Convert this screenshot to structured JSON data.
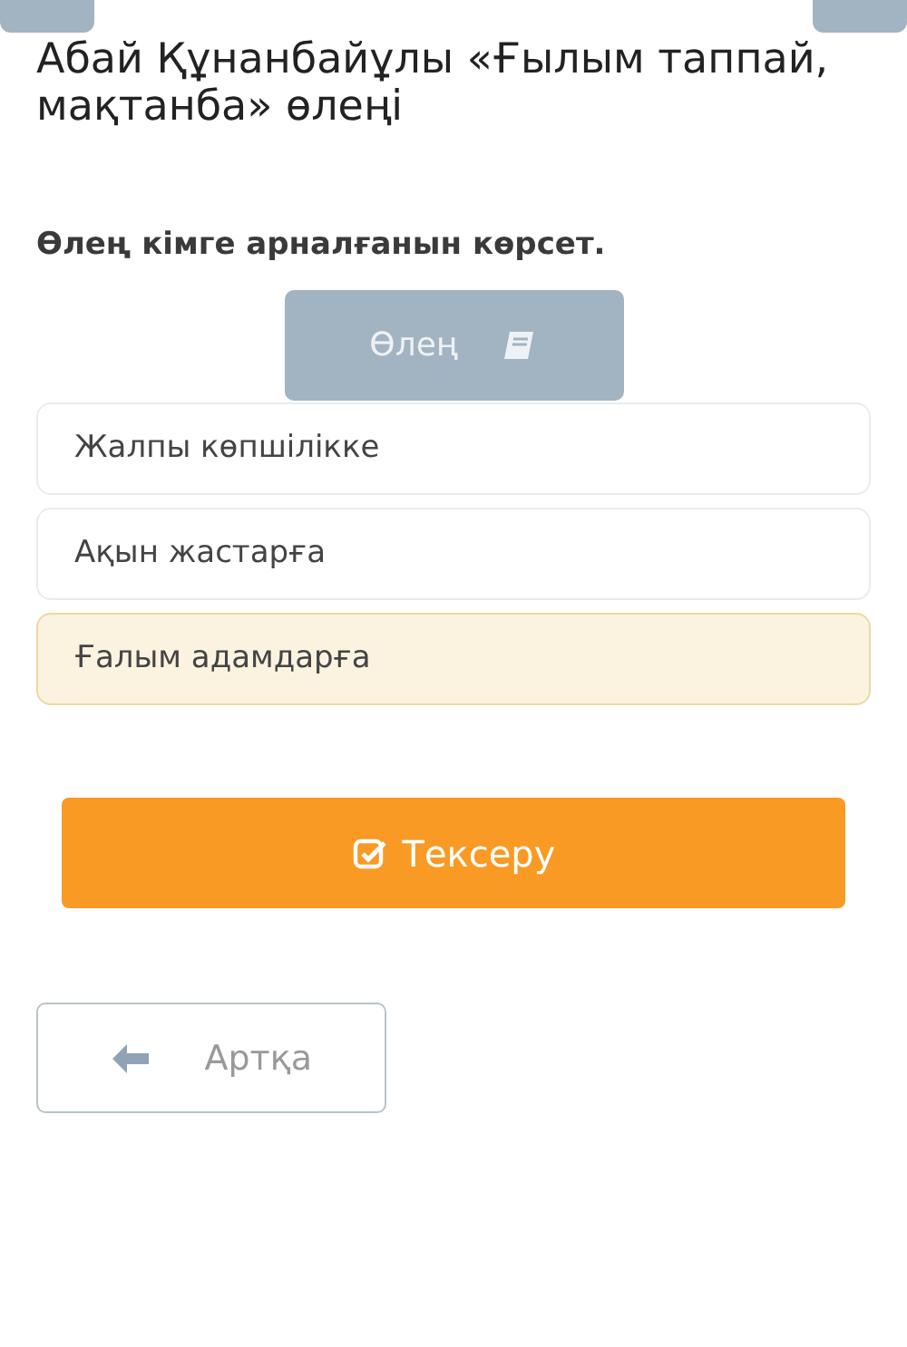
{
  "title": "Абай Құнанбайұлы «Ғылым таппай, мақтанба» өлеңі",
  "question": "Өлең кімге арналғанын көрсет.",
  "poem_button": {
    "label": "Өлең"
  },
  "options": [
    {
      "label": "Жалпы көпшілікке",
      "selected": false
    },
    {
      "label": "Ақын жастарға",
      "selected": false
    },
    {
      "label": "Ғалым адамдарға",
      "selected": true
    }
  ],
  "check_button": {
    "label": "Тексеру"
  },
  "back_button": {
    "label": "Артқа"
  }
}
